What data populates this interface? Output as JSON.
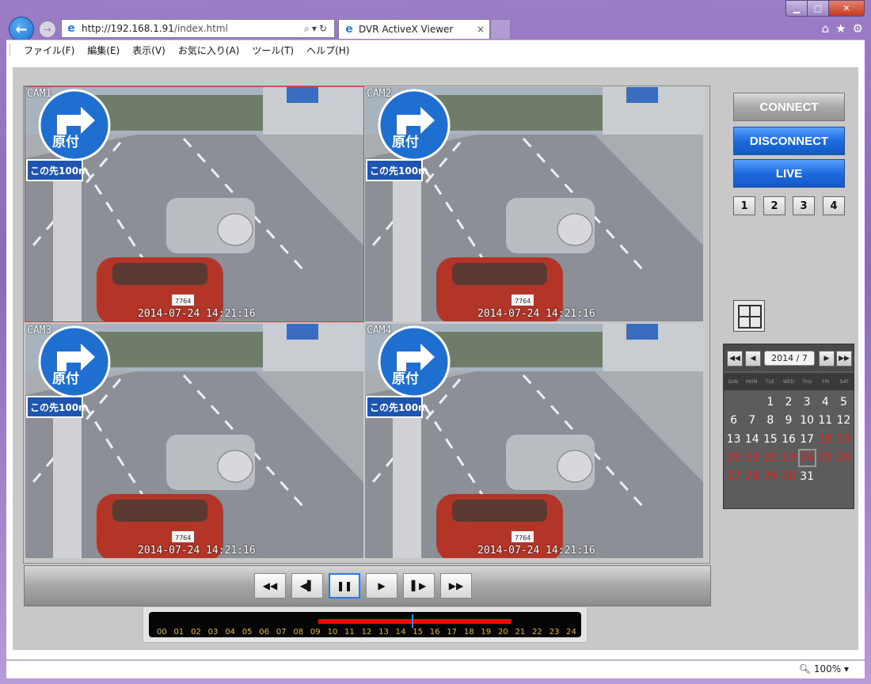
{
  "browser": {
    "url_host": "http://192.168.1.91",
    "url_path": "/index.html",
    "tab_title": "DVR ActiveX Viewer",
    "tab_close": "×",
    "zoom": "100%",
    "menu": [
      "ファイル(F)",
      "編集(E)",
      "表示(V)",
      "お気に入り(A)",
      "ツール(T)",
      "ヘルプ(H)"
    ]
  },
  "cameras": [
    {
      "label": "CAM1",
      "timestamp": "2014-07-24 14:21:16",
      "selected": true
    },
    {
      "label": "CAM2",
      "timestamp": "2014-07-24 14:21:16",
      "selected": false
    },
    {
      "label": "CAM3",
      "timestamp": "2014-07-24 14:21:16",
      "selected": false
    },
    {
      "label": "CAM4",
      "timestamp": "2014-07-24 14:21:16",
      "selected": false
    }
  ],
  "scene": {
    "sign_text": "原付",
    "subsign_text": "この先100m",
    "plate_text": "7764"
  },
  "controls": {
    "connect": "CONNECT",
    "disconnect": "DISCONNECT",
    "live": "LIVE",
    "channels": [
      "1",
      "2",
      "3",
      "4"
    ]
  },
  "playback": {
    "buttons": [
      "rewind",
      "step-back",
      "pause",
      "play",
      "step-forward",
      "fast-forward"
    ],
    "active": "pause"
  },
  "timeline": {
    "hours": [
      "00",
      "01",
      "02",
      "03",
      "04",
      "05",
      "06",
      "07",
      "08",
      "09",
      "10",
      "11",
      "12",
      "13",
      "14",
      "15",
      "16",
      "17",
      "18",
      "19",
      "20",
      "21",
      "22",
      "23",
      "24"
    ],
    "recorded_from_hour": 9,
    "recorded_to_hour": 20,
    "cursor_hour": 14.35
  },
  "calendar": {
    "month_label": "2014 / 7",
    "weekdays": [
      "SUN",
      "MON",
      "TUE",
      "WED",
      "THU",
      "FRI",
      "SAT"
    ],
    "first_weekday": 2,
    "days": 31,
    "selected_day": 24,
    "recorded_days": [
      1,
      2,
      3,
      4,
      5,
      6,
      7,
      8,
      9,
      10,
      11,
      12,
      13,
      14,
      15,
      16,
      17,
      31
    ],
    "colors": {
      "normal": "#ffffff",
      "no_record": "#e0201c"
    }
  }
}
